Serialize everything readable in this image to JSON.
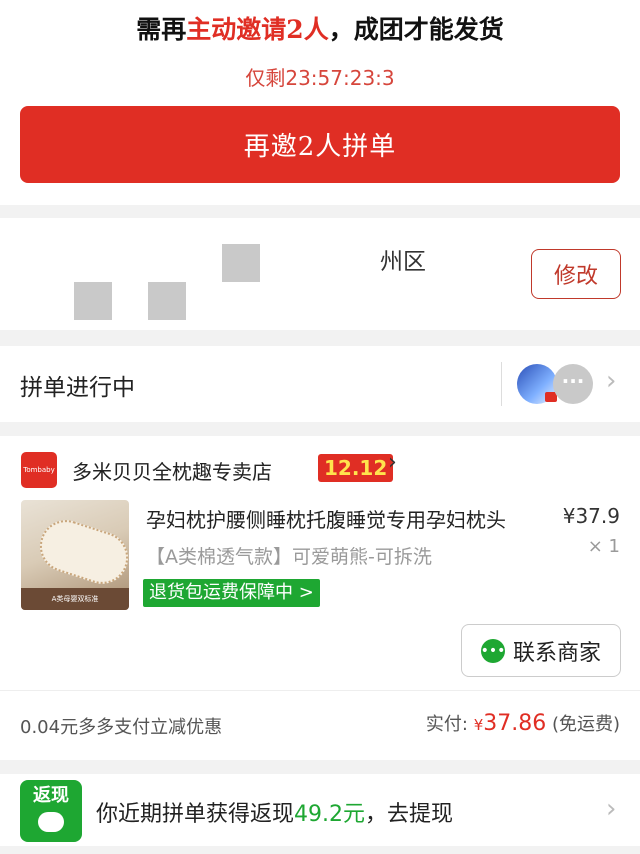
{
  "header": {
    "title_pre": "需再",
    "title_highlight": "主动邀请2人",
    "title_post": "，成团才能发货",
    "countdown": "仅剩23:57:23:3",
    "invite_button": "再邀2人拼单"
  },
  "address": {
    "text": "州区",
    "edit_button": "修改"
  },
  "group": {
    "label": "拼单进行中",
    "more": "···"
  },
  "order": {
    "store_logo_text": "Tombaby",
    "store_name": "多米贝贝全枕趣专卖店",
    "store_badge": "12.12",
    "product_title": "孕妇枕护腰侧睡枕托腹睡觉专用孕妇枕头",
    "price": "¥37.9",
    "spec": "【A类棉透气款】可爱萌熊-可拆洗",
    "qty": "× 1",
    "return_tag": "退货包运费保障中 >",
    "image_strip_text": "A类母婴双标准",
    "contact_button": "联系商家",
    "discount_text": "0.04元多多支付立减优惠",
    "paid_label": "实付:",
    "paid_currency": "¥",
    "paid_amount": "37.86",
    "paid_note": "(免运费)"
  },
  "cashback": {
    "icon_text": "返现",
    "text_pre": "你近期拼单获得返现",
    "amount": "49.2元",
    "text_post": "，去提现"
  },
  "colors": {
    "primary_red": "#e02e24",
    "green": "#1ea732"
  }
}
